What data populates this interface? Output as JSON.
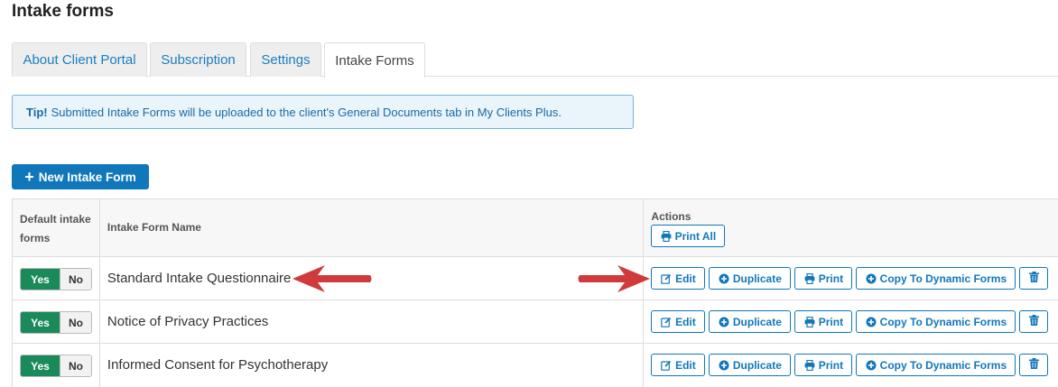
{
  "page": {
    "title": "Intake forms"
  },
  "tabs": [
    {
      "label": "About Client Portal",
      "active": false
    },
    {
      "label": "Subscription",
      "active": false
    },
    {
      "label": "Settings",
      "active": false
    },
    {
      "label": "Intake Forms",
      "active": true
    }
  ],
  "tip": {
    "prefix": "Tip!",
    "text": "Submitted Intake Forms will be uploaded to the client's General Documents tab in My Clients Plus."
  },
  "new_button": {
    "label": "New Intake Form",
    "icon": "plus-icon"
  },
  "table": {
    "headers": {
      "default": "Default intake forms",
      "name": "Intake Form Name",
      "actions": "Actions",
      "print_all": "Print All"
    },
    "toggle": {
      "yes": "Yes",
      "no": "No"
    },
    "action_labels": {
      "edit": "Edit",
      "duplicate": "Duplicate",
      "print": "Print",
      "copy": "Copy To Dynamic Forms"
    },
    "rows": [
      {
        "name": "Standard Intake Questionnaire",
        "default": "Yes"
      },
      {
        "name": "Notice of Privacy Practices",
        "default": "Yes"
      },
      {
        "name": "Informed Consent for Psychotherapy",
        "default": "Yes"
      }
    ]
  },
  "colors": {
    "primary": "#1177bb",
    "toggle_on": "#1a8a5a",
    "arrow": "#d03a3a",
    "tip_bg": "#e9f4fb"
  }
}
